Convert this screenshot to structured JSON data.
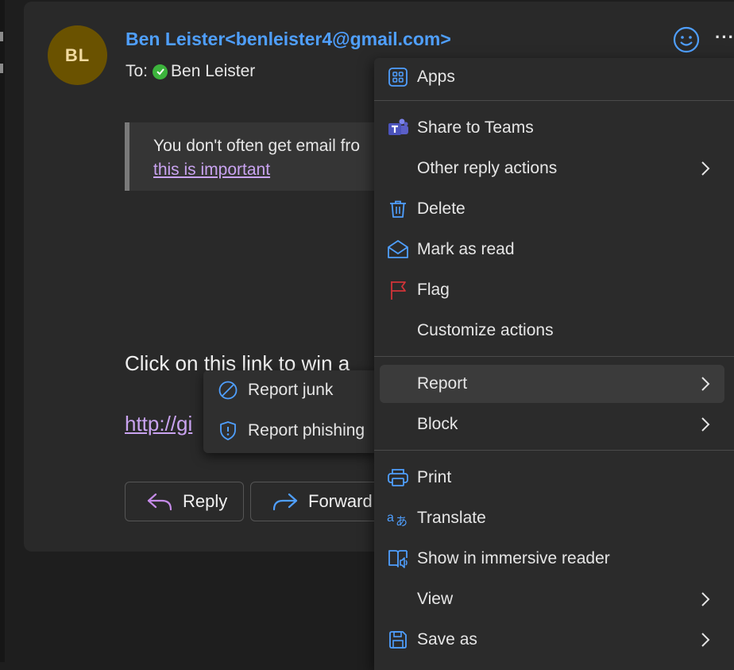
{
  "email": {
    "avatar_initials": "BL",
    "sender": "Ben Leister<benleister4@gmail.com>",
    "to_label": "To:",
    "recipient": "Ben Leister",
    "banner_text": "You don't often get email fro",
    "banner_link": "this is important",
    "body_text": "Click on this link to win a",
    "body_link": "http://gi",
    "reply_label": "Reply",
    "forward_label": "Forward"
  },
  "menu": {
    "items": [
      {
        "label": "Apps",
        "icon": "apps-icon"
      },
      {
        "label": "Share to Teams",
        "icon": "teams-icon"
      },
      {
        "label": "Other reply actions",
        "icon": "",
        "submenu": true
      },
      {
        "label": "Delete",
        "icon": "trash-icon"
      },
      {
        "label": "Mark as read",
        "icon": "envelope-open-icon"
      },
      {
        "label": "Flag",
        "icon": "flag-icon"
      },
      {
        "label": "Customize actions",
        "icon": ""
      },
      {
        "label": "Report",
        "icon": "",
        "submenu": true,
        "highlighted": true
      },
      {
        "label": "Block",
        "icon": "",
        "submenu": true
      },
      {
        "label": "Print",
        "icon": "printer-icon"
      },
      {
        "label": "Translate",
        "icon": "translate-icon"
      },
      {
        "label": "Show in immersive reader",
        "icon": "immersive-reader-icon"
      },
      {
        "label": "View",
        "icon": "",
        "submenu": true
      },
      {
        "label": "Save as",
        "icon": "save-icon",
        "submenu": true
      }
    ]
  },
  "report_submenu": {
    "items": [
      {
        "label": "Report junk",
        "icon": "block-circle-icon"
      },
      {
        "label": "Report phishing",
        "icon": "shield-alert-icon"
      }
    ]
  },
  "colors": {
    "accent_blue": "#4f9fff",
    "link_purple": "#c9a3f0",
    "flag_red": "#d13438",
    "avatar_bg": "#6a5200"
  }
}
